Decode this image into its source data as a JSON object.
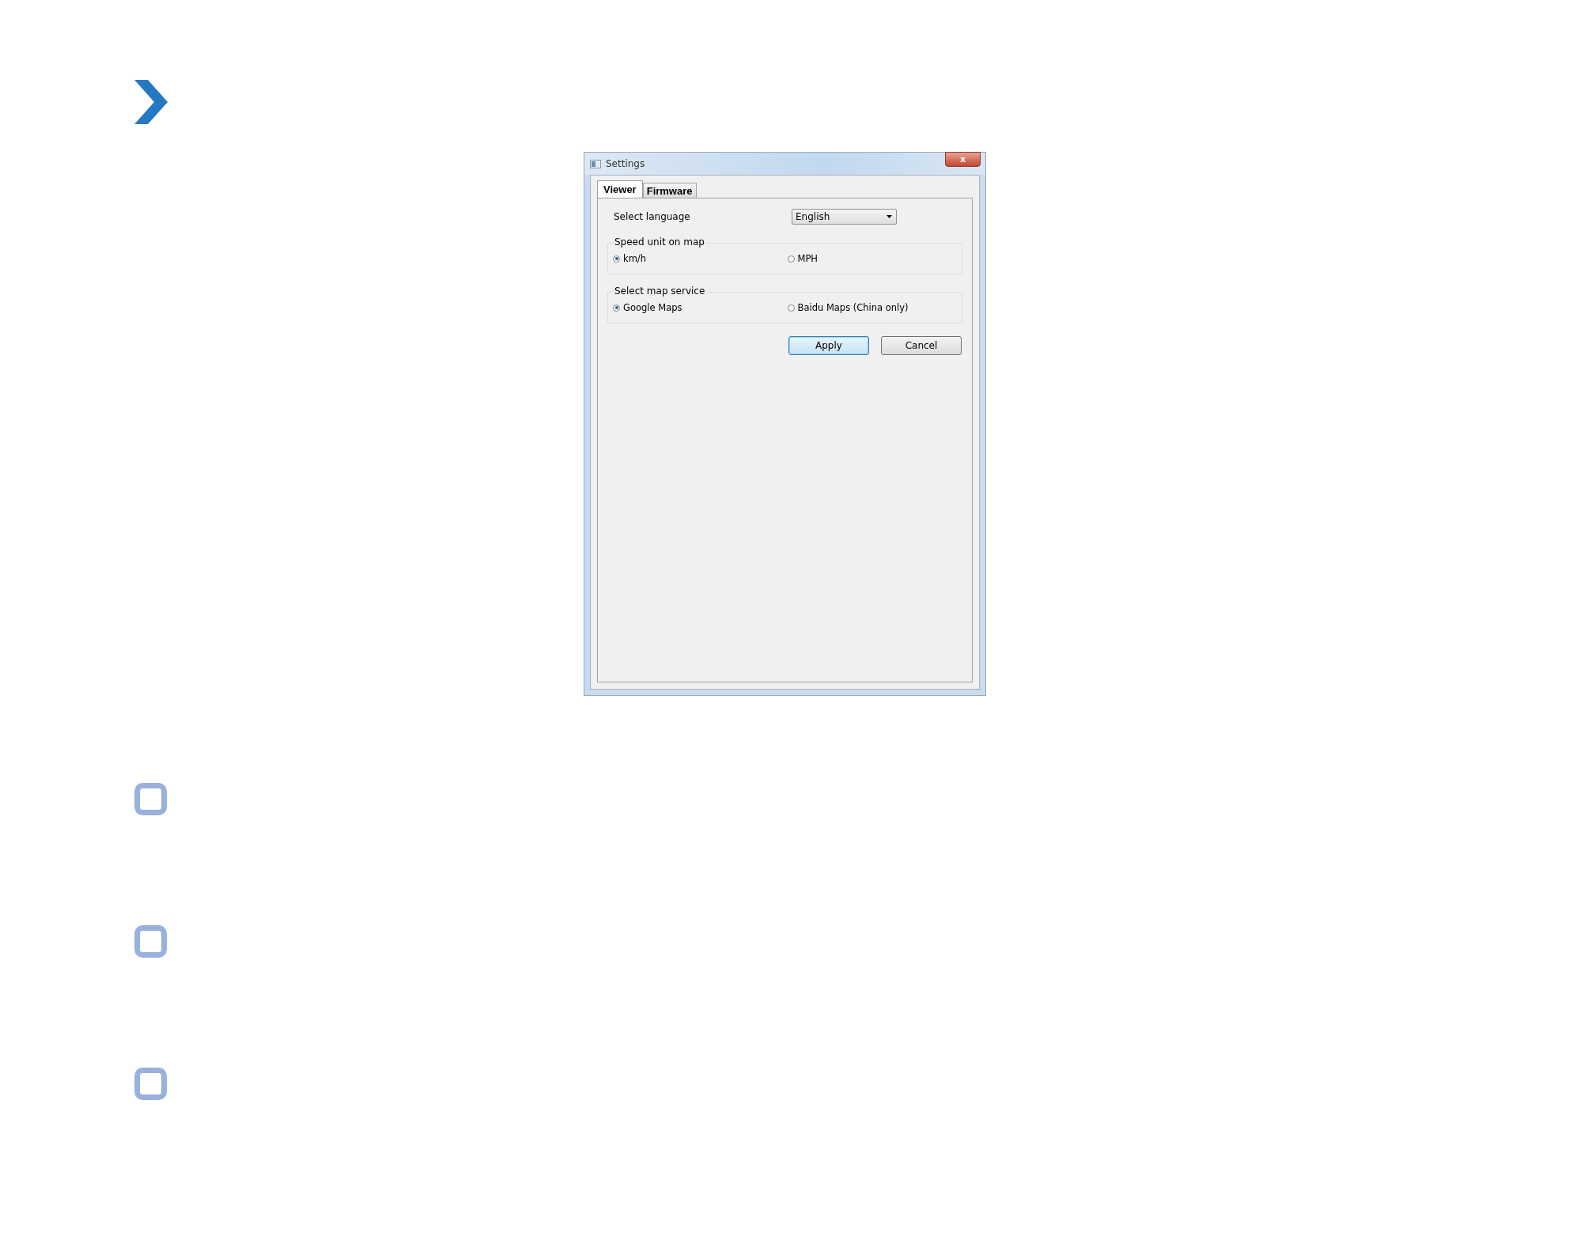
{
  "window": {
    "title": "Settings",
    "close": "x"
  },
  "tabs": [
    {
      "label": "Viewer",
      "selected": true
    },
    {
      "label": "Firmware",
      "selected": false
    }
  ],
  "language": {
    "label": "Select language",
    "value": "English"
  },
  "groups": [
    {
      "title": "Speed unit on map",
      "options": [
        {
          "label": "km/h",
          "selected": true
        },
        {
          "label": "MPH",
          "selected": false
        }
      ]
    },
    {
      "title": "Select map service",
      "options": [
        {
          "label": "Google Maps",
          "selected": true
        },
        {
          "label": "Baidu Maps (China only)",
          "selected": false
        }
      ]
    }
  ],
  "buttons": [
    {
      "label": "Apply",
      "default": true
    },
    {
      "label": "Cancel",
      "default": false
    }
  ]
}
